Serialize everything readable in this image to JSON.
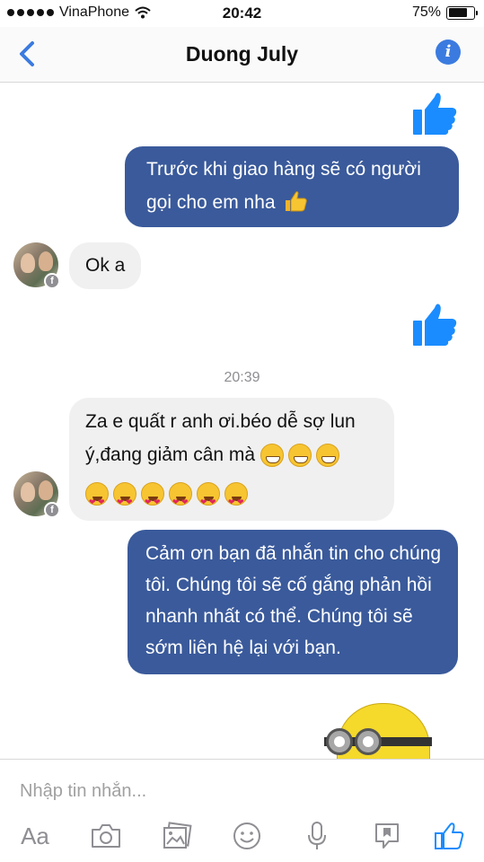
{
  "status_bar": {
    "carrier": "VinaPhone",
    "time": "20:42",
    "battery": "75%"
  },
  "nav": {
    "title": "Duong July"
  },
  "conversation": {
    "msg_outgoing_1": "Trước khi giao hàng sẽ có người gọi cho em nha",
    "msg_incoming_1": "Ok a",
    "timestamp": "20:39",
    "msg_incoming_2": "Za e quất r anh ơi.béo dễ sợ lun ý,đang giảm cân mà",
    "msg_outgoing_2": "Cảm ơn bạn đã nhắn tin cho chúng tôi. Chúng tôi sẽ cố gắng phản hồi nhanh nhất có thể. Chúng tôi sẽ sớm liên hệ lại với bạn."
  },
  "composer": {
    "placeholder": "Nhập tin nhắn...",
    "aa_label": "Aa"
  },
  "colors": {
    "accent": "#3b7be0",
    "outgoing_bubble": "#3a5a9b",
    "incoming_bubble": "#f0f0f0",
    "like": "#1a8cff"
  }
}
